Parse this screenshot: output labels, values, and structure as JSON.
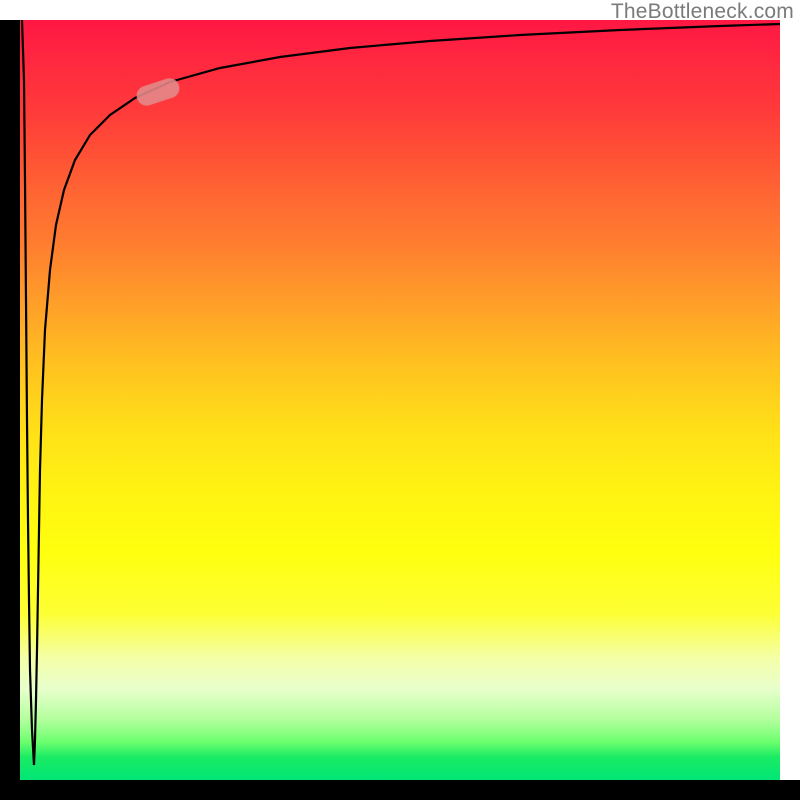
{
  "watermark": "TheBottleneck.com",
  "colors": {
    "gradient_top": "#ff1744",
    "gradient_mid": "#ffff0f",
    "gradient_bottom": "#00e676",
    "axis": "#000000",
    "curve": "#000000",
    "marker": "rgba(229,138,138,0.88)"
  },
  "chart_data": {
    "type": "line",
    "title": "",
    "xlabel": "",
    "ylabel": "",
    "xlim": [
      0,
      100
    ],
    "ylim": [
      0,
      100
    ],
    "grid": false,
    "legend": false,
    "background": {
      "type": "vertical-gradient",
      "stops": [
        {
          "pos": 0.0,
          "color": "#ff1744"
        },
        {
          "pos": 0.5,
          "color": "#ffe018"
        },
        {
          "pos": 0.7,
          "color": "#ffff0f"
        },
        {
          "pos": 1.0,
          "color": "#00e676"
        }
      ],
      "note": "y=100 at top (red) down to y=0 at bottom (green); color roughly encodes bottleneck severity"
    },
    "series": [
      {
        "name": "left-descent",
        "note": "steep drop from y≈100 to y≈2 over x≈0 to x≈1.8; values estimated from pixels",
        "x": [
          0.3,
          0.5,
          0.7,
          0.8,
          0.9,
          1.0,
          1.1,
          1.2,
          1.3,
          1.6,
          1.8
        ],
        "values": [
          100,
          92,
          79,
          63,
          47,
          34,
          24,
          14,
          7,
          3,
          2
        ]
      },
      {
        "name": "main-curve",
        "note": "logarithmic rise from near y≈2 back toward y≈99.5 as x→100; values estimated from pixels",
        "x": [
          1.8,
          2.0,
          2.1,
          2.2,
          2.4,
          2.5,
          2.6,
          2.9,
          3.3,
          3.9,
          4.7,
          5.8,
          7.2,
          9.2,
          11.8,
          15.1,
          19.7,
          26.3,
          34.2,
          43.4,
          53.9,
          65.8,
          78.9,
          92.1,
          100.0
        ],
        "values": [
          2.0,
          5.3,
          10.5,
          17.1,
          25.0,
          32.9,
          40.8,
          50.0,
          59.2,
          67.1,
          73.0,
          77.6,
          81.1,
          84.9,
          87.5,
          89.7,
          91.8,
          93.7,
          95.1,
          96.3,
          97.2,
          98.0,
          98.7,
          99.2,
          99.5
        ]
      }
    ],
    "marker": {
      "note": "rounded pill highlight on the main curve shoulder",
      "x_approx": 18,
      "y_approx": 90.4,
      "angle_deg": -18
    }
  }
}
